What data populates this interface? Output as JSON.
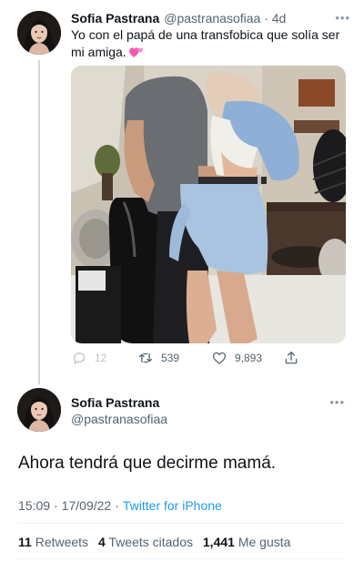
{
  "tweet": {
    "author_name": "Sofia Pastrana",
    "author_handle": "@pastranasofiaa",
    "age": "· 4d",
    "more_icon": "more-icon",
    "text": "Yo con el papá de una transfobica que solía ser mi amiga.",
    "emoji": "two-hearts-emoji",
    "media_alt": "photo",
    "actions": {
      "reply_count": "12",
      "retweet_count": "539",
      "like_count": "9,893",
      "reply_icon": "reply-icon",
      "retweet_icon": "retweet-icon",
      "like_icon": "heart-icon",
      "share_icon": "share-icon"
    }
  },
  "reply": {
    "author_name": "Sofia Pastrana",
    "author_handle": "@pastranasofiaa",
    "more_icon": "more-icon",
    "text": "Ahora tendrá que decirme mamá.",
    "time": "15:09",
    "date": "17/09/22",
    "source": "Twitter for iPhone",
    "stats": {
      "retweets_count": "11",
      "retweets_label": "Retweets",
      "quotes_count": "4",
      "quotes_label": "Tweets citados",
      "likes_count": "1,441",
      "likes_label": "Me gusta"
    }
  },
  "colors": {
    "link": "#1d9bf0",
    "secondary_text": "#536471",
    "thread_line": "#cfd9de"
  }
}
